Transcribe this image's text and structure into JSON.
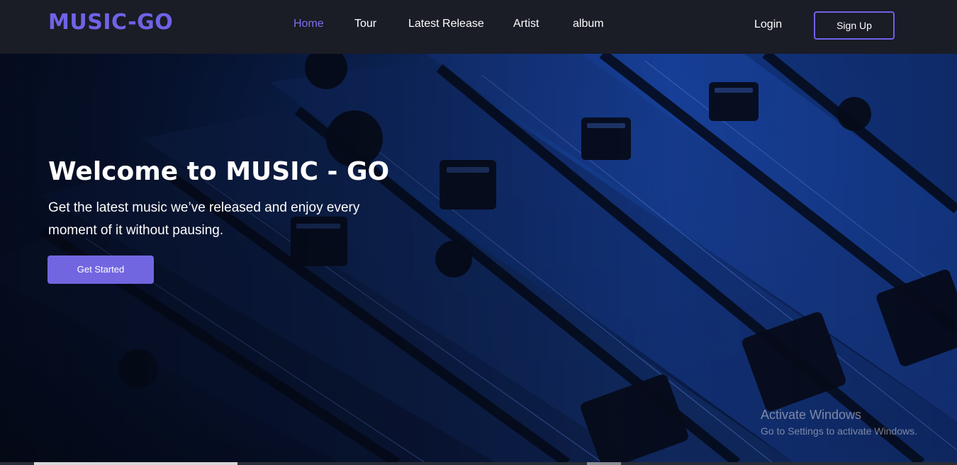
{
  "brand": {
    "name": "MUSIC-GO"
  },
  "nav": {
    "items": [
      {
        "label": "Home",
        "active": true
      },
      {
        "label": "Tour",
        "active": false
      },
      {
        "label": "Latest Release",
        "active": false
      },
      {
        "label": "Artist",
        "active": false
      },
      {
        "label": "album",
        "active": false
      }
    ],
    "login_label": "Login",
    "signup_label": "Sign Up"
  },
  "hero": {
    "title": "Welcome to MUSIC - GO",
    "subtitle": "Get the latest music we’ve released and enjoy every moment of it without pausing.",
    "cta_label": "Get Started",
    "background_icon": "mixing-console-image"
  },
  "watermark": {
    "title": "Activate Windows",
    "subtitle": "Go to Settings to activate Windows."
  },
  "colors": {
    "accent": "#6f63e6",
    "nav_active": "#7b70ee",
    "navbar_bg": "#1a1c26",
    "button_bg": "#7266e0"
  }
}
